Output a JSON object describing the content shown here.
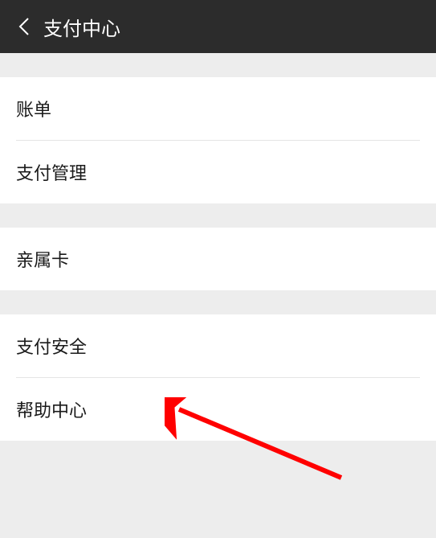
{
  "header": {
    "title": "支付中心"
  },
  "groups": [
    {
      "items": [
        {
          "label": "账单"
        },
        {
          "label": "支付管理"
        }
      ]
    },
    {
      "items": [
        {
          "label": "亲属卡"
        }
      ]
    },
    {
      "items": [
        {
          "label": "支付安全"
        },
        {
          "label": "帮助中心"
        }
      ]
    }
  ]
}
